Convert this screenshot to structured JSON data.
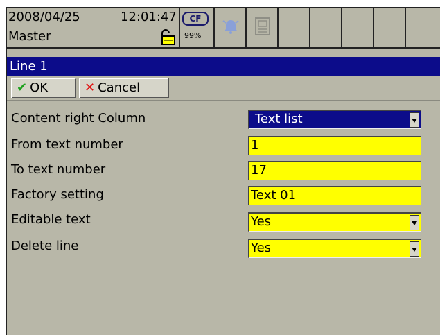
{
  "status": {
    "date": "2008/04/25",
    "time": "12:01:47",
    "user": "Master",
    "cf_label": "CF",
    "cf_percent": "99%"
  },
  "title": "Line 1",
  "toolbar": {
    "ok_label": "OK",
    "cancel_label": "Cancel"
  },
  "form": {
    "content_right_column": {
      "label": "Content right Column",
      "value": "Text list"
    },
    "from_text_number": {
      "label": "From text number",
      "value": "1"
    },
    "to_text_number": {
      "label": "To text number",
      "value": "17"
    },
    "factory_setting": {
      "label": "Factory setting",
      "value": "Text 01"
    },
    "editable_text": {
      "label": "Editable text",
      "value": "Yes"
    },
    "delete_line": {
      "label": "Delete line",
      "value": "Yes"
    }
  },
  "colors": {
    "background": "#b8b7a8",
    "titlebar": "#0c0c8a",
    "field_yellow": "#ffff00"
  }
}
